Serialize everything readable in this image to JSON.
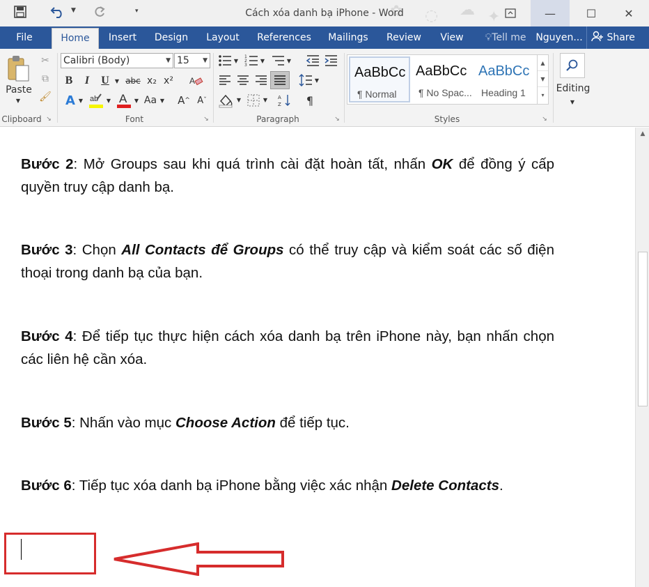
{
  "window": {
    "title": "Cách xóa danh bạ iPhone - Word",
    "qat": {
      "save_icon": "save-icon",
      "undo_icon": "undo-icon",
      "redo_icon": "redo-icon"
    },
    "controls": {
      "restore": "⧉",
      "minimize": "—",
      "maximize": "☐",
      "close": "✕"
    }
  },
  "tabs": {
    "file": "File",
    "home": "Home",
    "insert": "Insert",
    "design": "Design",
    "layout": "Layout",
    "references": "References",
    "mailings": "Mailings",
    "review": "Review",
    "view": "View",
    "tell_me": "Tell me",
    "user": "Nguyen...",
    "share": "Share"
  },
  "ribbon": {
    "clipboard": {
      "label": "Clipboard",
      "paste": "Paste"
    },
    "font": {
      "label": "Font",
      "font_name": "Calibri (Body)",
      "font_size": "15",
      "aa_label": "Aa"
    },
    "paragraph": {
      "label": "Paragraph"
    },
    "styles": {
      "label": "Styles",
      "items": [
        {
          "preview": "AaBbCc",
          "name": "¶ Normal"
        },
        {
          "preview": "AaBbCc",
          "name": "¶ No Spac..."
        },
        {
          "preview": "AaBbCc",
          "name": "Heading 1"
        }
      ]
    },
    "editing": {
      "label": "Editing"
    }
  },
  "document": {
    "paragraphs": [
      {
        "bold_lead": "Bước 2",
        "text": ": Mở Groups sau khi quá trình cài đặt hoàn tất, nhấn ",
        "bold_italic": "OK",
        "tail": " để đồng ý cấp quyền truy cập danh bạ."
      },
      {
        "bold_lead": "Bước 3",
        "text": ": Chọn ",
        "bold_italic": "All Contacts để Groups",
        "tail": " có thể truy cập và kiểm soát các số điện thoại trong danh bạ của bạn."
      },
      {
        "bold_lead": "Bước 4",
        "text": ": Để tiếp tục thực hiện cách xóa danh bạ trên iPhone này, bạn nhấn chọn các liên hệ cần xóa.",
        "bold_italic": "",
        "tail": ""
      },
      {
        "bold_lead": "Bước 5",
        "text": ": Nhấn vào mục ",
        "bold_italic": "Choose Action",
        "tail": " để tiếp tục."
      },
      {
        "bold_lead": "Bước 6",
        "text": ": Tiếp tục xóa danh bạ iPhone bằng việc xác nhận ",
        "bold_italic": "Delete Contacts",
        "tail": "."
      }
    ]
  },
  "colors": {
    "accent": "#2b579a",
    "annotation": "#d62c2c"
  }
}
